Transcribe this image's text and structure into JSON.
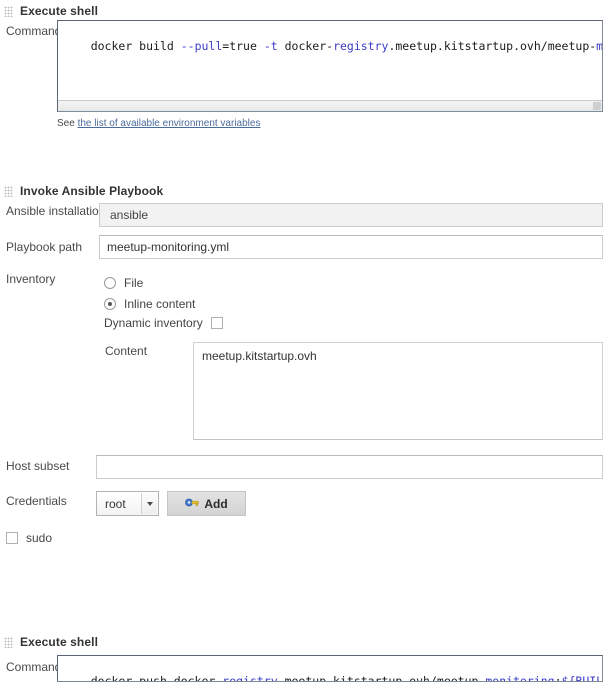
{
  "sections": [
    {
      "title": "Execute shell",
      "grip_icon": "drag-grip-icon",
      "command_label": "Command",
      "command_tokens": [
        {
          "t": "docker build ",
          "kw": false
        },
        {
          "t": "--pull",
          "kw": true
        },
        {
          "t": "=true ",
          "kw": false
        },
        {
          "t": "-t",
          "kw": true
        },
        {
          "t": " docker-",
          "kw": false
        },
        {
          "t": "registry",
          "kw": true
        },
        {
          "t": ".meetup.kitstartup.ovh/meetup-",
          "kw": false
        },
        {
          "t": "monitoring",
          "kw": true
        },
        {
          "t": ":$",
          "kw": true
        }
      ],
      "command_value": "docker build --pull=true -t docker-registry.meetup.kitstartup.ovh/meetup-monitoring:${BUILD_NUMBER}",
      "help_prefix": "See ",
      "help_link": "the list of available environment variables"
    }
  ],
  "ansible": {
    "title": "Invoke Ansible Playbook",
    "grip_icon": "drag-grip-icon",
    "installation": {
      "label": "Ansible installation",
      "value": "ansible"
    },
    "playbook": {
      "label": "Playbook path",
      "value": "meetup-monitoring.yml"
    },
    "inventory": {
      "label": "Inventory",
      "file_option": "File",
      "file_selected": false,
      "inline_option": "Inline content",
      "inline_selected": true,
      "dynamic_label": "Dynamic inventory",
      "dynamic_checked": false,
      "content_label": "Content",
      "content_value": "meetup.kitstartup.ovh"
    },
    "host_subset": {
      "label": "Host subset",
      "value": "",
      "placeholder": ""
    },
    "credentials": {
      "label": "Credentials",
      "value": "root",
      "add_label": "Add",
      "add_icon": "key-icon",
      "caret_icon": "chevron-down-icon"
    },
    "sudo": {
      "label": "sudo",
      "checked": false
    }
  },
  "shell_bottom": {
    "title": "Execute shell",
    "grip_icon": "drag-grip-icon",
    "command_label": "Command",
    "command_tokens": [
      {
        "t": "docker push docker-",
        "kw": false
      },
      {
        "t": "registry",
        "kw": true
      },
      {
        "t": ".meetup.kitstartup.ovh/meetup-",
        "kw": false
      },
      {
        "t": "monitoring",
        "kw": true
      },
      {
        "t": ":",
        "kw": false
      },
      {
        "t": "${BUILD_NUMBER}",
        "kw": true
      }
    ],
    "command_value": "docker push docker-registry.meetup.kitstartup.ovh/meetup-monitoring:${BUILD_NUMBER}"
  },
  "colors": {
    "keyword": "#3b3bc8",
    "link": "#4a6c9b",
    "label": "#4a4a4a",
    "border": "#cccccc"
  }
}
